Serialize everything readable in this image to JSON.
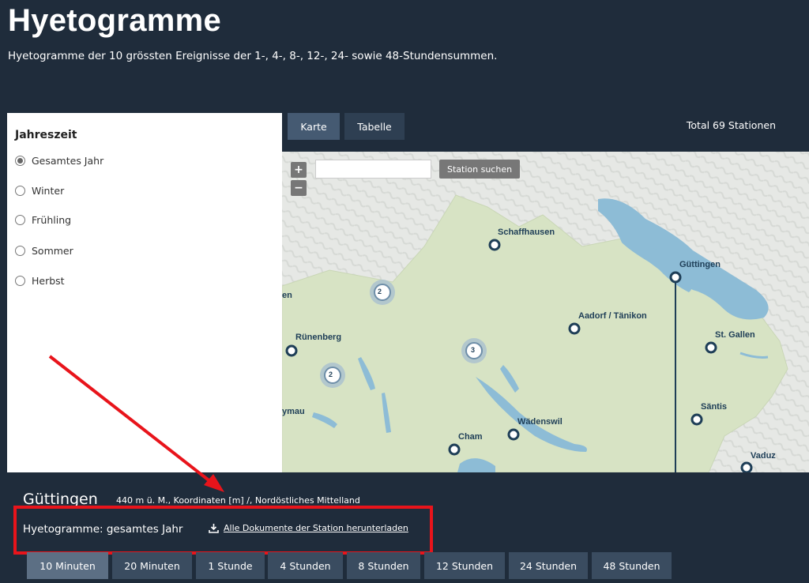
{
  "header": {
    "title": "Hyetogramme",
    "subtitle": "Hyetogramme der 10 grössten Ereignisse der 1-, 4-, 8-, 12-, 24- sowie 48-Stundensummen."
  },
  "filter": {
    "heading": "Jahreszeit",
    "options": [
      {
        "label": "Gesamtes Jahr",
        "checked": true
      },
      {
        "label": "Winter",
        "checked": false
      },
      {
        "label": "Frühling",
        "checked": false
      },
      {
        "label": "Sommer",
        "checked": false
      },
      {
        "label": "Herbst",
        "checked": false
      }
    ]
  },
  "view_tabs": [
    {
      "label": "Karte",
      "active": true
    },
    {
      "label": "Tabelle",
      "active": false
    }
  ],
  "total_stations": "Total 69 Stationen",
  "map": {
    "zoom_in": "+",
    "zoom_out": "−",
    "search_placeholder": "",
    "search_button": "Station suchen",
    "stations": [
      {
        "name": "Schaffhausen"
      },
      {
        "name": "Güttingen"
      },
      {
        "name": "Aadorf / Tänikon"
      },
      {
        "name": "St. Gallen"
      },
      {
        "name": "Rünenberg"
      },
      {
        "name": "Säntis"
      },
      {
        "name": "Wädenswil"
      },
      {
        "name": "Cham"
      },
      {
        "name": "Vaduz"
      },
      {
        "name": "en"
      },
      {
        "name": "ymau"
      }
    ],
    "clusters": [
      "2",
      "3",
      "2"
    ]
  },
  "station_detail": {
    "name": "Güttingen",
    "meta": "440 m ü. M., Koordinaten [m] /, Nordöstliches Mittelland",
    "hyeto_label": "Hyetogramme: gesamtes Jahr",
    "download_label": "Alle Dokumente der Station herunterladen"
  },
  "duration_tabs": [
    {
      "label": "10 Minuten",
      "active": true
    },
    {
      "label": "20 Minuten",
      "active": false
    },
    {
      "label": "1 Stunde",
      "active": false
    },
    {
      "label": "4 Stunden",
      "active": false
    },
    {
      "label": "8 Stunden",
      "active": false
    },
    {
      "label": "12 Stunden",
      "active": false
    },
    {
      "label": "24 Stunden",
      "active": false
    },
    {
      "label": "48 Stunden",
      "active": false
    }
  ],
  "colors": {
    "background": "#1f2c3b",
    "highlight": "#e8141b",
    "station_marker": "#1e3e57",
    "lake": "#8dbcd6",
    "land": "#d7e3c4"
  }
}
